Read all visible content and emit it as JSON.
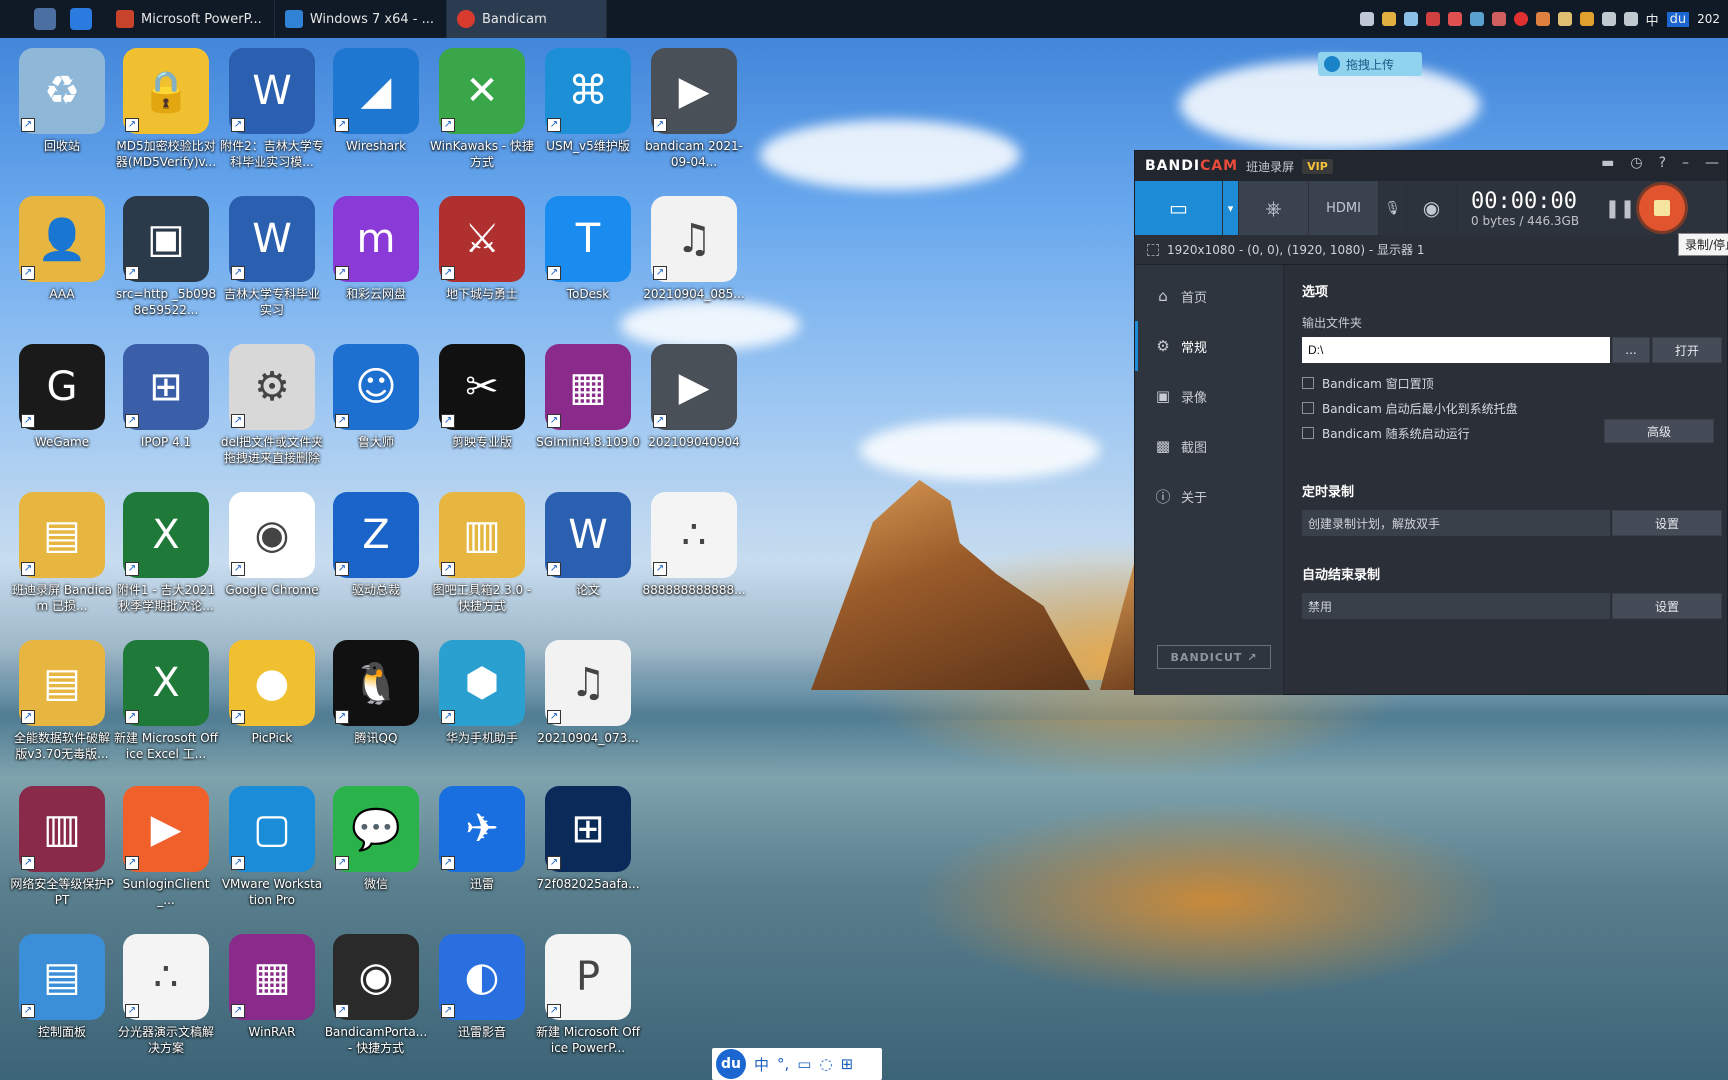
{
  "taskbar": {
    "tasks": [
      {
        "label": "Microsoft PowerP...",
        "color": "#c8432b"
      },
      {
        "label": "Windows 7 x64 - ...",
        "color": "#2f82d4"
      },
      {
        "label": "Bandicam",
        "color": "#d93a2e"
      }
    ],
    "tray_lang": "中",
    "tray_du": "du",
    "clock_year": "202"
  },
  "upload": {
    "label": "拖拽上传"
  },
  "desktop": {
    "icons": [
      {
        "label": "回收站",
        "color": "#8fb8d8",
        "glyph": "♻"
      },
      {
        "label": "MD5加密校验比对器(MD5Verify)v...",
        "color": "#f0c030",
        "glyph": "🔒"
      },
      {
        "label": "附件2：吉林大学专科毕业实习模...",
        "color": "#2b5faf",
        "glyph": "W"
      },
      {
        "label": "Wireshark",
        "color": "#1e77d0",
        "glyph": "◢"
      },
      {
        "label": "WinKawaks - 快捷方式",
        "color": "#3aa64a",
        "glyph": "✕"
      },
      {
        "label": "USM_v5维护版",
        "color": "#1c8fd6",
        "glyph": "⌘"
      },
      {
        "label": "bandicam 2021-09-04...",
        "color": "#4a5058",
        "glyph": "▶"
      },
      {
        "label": "AAA",
        "color": "#e6b640",
        "glyph": "👤"
      },
      {
        "label": "src=http _5b0988e59522...",
        "color": "#2a3a4a",
        "glyph": "▣"
      },
      {
        "label": "吉林大学专科毕业实习",
        "color": "#2b5faf",
        "glyph": "W"
      },
      {
        "label": "和彩云网盘",
        "color": "#8a3ad6",
        "glyph": "m"
      },
      {
        "label": "地下城与勇士",
        "color": "#b03030",
        "glyph": "⚔"
      },
      {
        "label": "ToDesk",
        "color": "#1a8cf0",
        "glyph": "T"
      },
      {
        "label": "20210904_085...",
        "color": "#f2f2f2",
        "glyph": "♫"
      },
      {
        "label": "WeGame",
        "color": "#1a1a1a",
        "glyph": "G"
      },
      {
        "label": "IPOP 4.1",
        "color": "#3b5ea8",
        "glyph": "⊞"
      },
      {
        "label": "del把文件或文件夹拖拽进来直接删除",
        "color": "#d8d8d8",
        "glyph": "⚙"
      },
      {
        "label": "鲁大师",
        "color": "#1d70d0",
        "glyph": "☺"
      },
      {
        "label": "剪映专业版",
        "color": "#111111",
        "glyph": "✂"
      },
      {
        "label": "SGImini4.8.109.0",
        "color": "#8a2a8a",
        "glyph": "▦"
      },
      {
        "label": "202109040904",
        "color": "#4a5058",
        "glyph": "▶"
      },
      {
        "label": "班迪录屏 Bandicam 已损...",
        "color": "#e6b640",
        "glyph": "▤"
      },
      {
        "label": "附件1 - 吉大2021秋季学期批次论...",
        "color": "#1f7a3a",
        "glyph": "X"
      },
      {
        "label": "Google Chrome",
        "color": "#ffffff",
        "glyph": "◉"
      },
      {
        "label": "驱动总裁",
        "color": "#1a63c8",
        "glyph": "Z"
      },
      {
        "label": "图吧工具箱2.3.0 - 快捷方式",
        "color": "#e6b640",
        "glyph": "▥"
      },
      {
        "label": "论文",
        "color": "#2b5faf",
        "glyph": "W"
      },
      {
        "label": "888888888888...",
        "color": "#f4f4f4",
        "glyph": "∴"
      },
      {
        "label": "全能数据软件破解版v3.70无毒版...",
        "color": "#e6b640",
        "glyph": "▤"
      },
      {
        "label": "新建 Microsoft Office Excel 工...",
        "color": "#1f7a3a",
        "glyph": "X"
      },
      {
        "label": "PicPick",
        "color": "#f0c030",
        "glyph": "●"
      },
      {
        "label": "腾讯QQ",
        "color": "#111111",
        "glyph": "🐧"
      },
      {
        "label": "华为手机助手",
        "color": "#2aa0d0",
        "glyph": "⬢"
      },
      {
        "label": "20210904_073...",
        "color": "#f2f2f2",
        "glyph": "♫"
      },
      {
        "label": "网络安全等级保护PPT",
        "color": "#8a2a4a",
        "glyph": "▥"
      },
      {
        "label": "SunloginClient_...",
        "color": "#f0602a",
        "glyph": "▶"
      },
      {
        "label": "VMware Workstation Pro",
        "color": "#1a8cd8",
        "glyph": "▢"
      },
      {
        "label": "微信",
        "color": "#2ab34a",
        "glyph": "💬"
      },
      {
        "label": "迅雷",
        "color": "#1a6fe0",
        "glyph": "✈"
      },
      {
        "label": "72f082025aafa...",
        "color": "#0a2a5a",
        "glyph": "⊞"
      },
      {
        "label": "控制面板",
        "color": "#3a8fd8",
        "glyph": "▤"
      },
      {
        "label": "分光器演示文稿解决方案",
        "color": "#f4f4f4",
        "glyph": "∴"
      },
      {
        "label": "WinRAR",
        "color": "#8a2a8a",
        "glyph": "▦"
      },
      {
        "label": "BandicamPorta... - 快捷方式",
        "color": "#2a2a2a",
        "glyph": "◉"
      },
      {
        "label": "迅雷影音",
        "color": "#2a6fe0",
        "glyph": "◐"
      },
      {
        "label": "新建 Microsoft Office PowerP...",
        "color": "#f4f4f4",
        "glyph": "P"
      }
    ]
  },
  "bandicam": {
    "logo_a": "BANDI",
    "logo_b": "CAM",
    "subtitle": "班迪录屏",
    "vip": "VIP",
    "timer": "00:00:00",
    "size": "0 bytes / 446.3GB",
    "tooltip": "录制/停止",
    "area": "1920x1080 - (0, 0), (1920, 1080) - 显示器 1",
    "nav": [
      "首页",
      "常规",
      "录像",
      "截图",
      "关于"
    ],
    "bandicut": "BANDICUT ↗",
    "options_title": "选项",
    "output_label": "输出文件夹",
    "output_value": "D:\\",
    "browse": "...",
    "open": "打开",
    "checks": [
      "Bandicam 窗口置顶",
      "Bandicam 启动后最小化到系统托盘",
      "Bandicam 随系统启动运行"
    ],
    "advanced": "高级",
    "timed_title": "定时录制",
    "timed_value": "创建录制计划，解放双手",
    "set": "设置",
    "autoend_title": "自动结束录制",
    "autoend_value": "禁用"
  },
  "ime": {
    "du": "du",
    "lang": "中",
    "punct": "°,"
  }
}
